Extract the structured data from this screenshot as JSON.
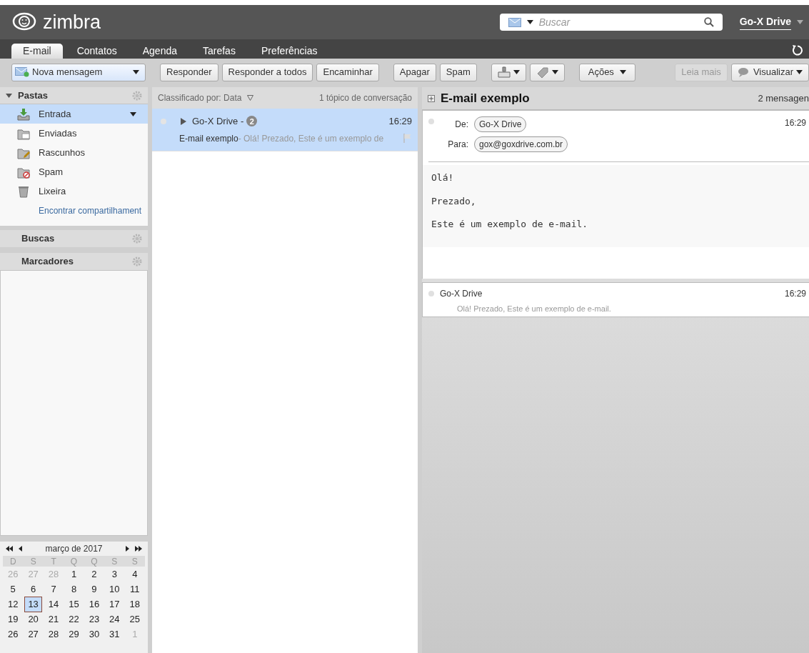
{
  "header": {
    "logo": "zimbra",
    "search": {
      "placeholder": "Buscar"
    },
    "user": "Go-X Drive"
  },
  "tabs": [
    {
      "label": "E-mail",
      "selected": true
    },
    {
      "label": "Contatos",
      "selected": false
    },
    {
      "label": "Agenda",
      "selected": false
    },
    {
      "label": "Tarefas",
      "selected": false
    },
    {
      "label": "Preferências",
      "selected": false
    }
  ],
  "toolbar": {
    "new_message": "Nova mensagem",
    "left_groups": [
      [
        {
          "kind": "text",
          "label": "Responder",
          "disabled": false
        },
        {
          "kind": "text",
          "label": "Responder a todos",
          "disabled": false
        },
        {
          "kind": "text",
          "label": "Encaminhar",
          "disabled": false
        }
      ],
      [
        {
          "kind": "text",
          "label": "Apagar",
          "disabled": false
        },
        {
          "kind": "text",
          "label": "Spam",
          "disabled": false
        }
      ],
      [
        {
          "kind": "move",
          "disabled": false
        },
        {
          "kind": "tag",
          "disabled": false
        }
      ],
      [
        {
          "kind": "menu",
          "label": "Ações",
          "disabled": false
        }
      ]
    ],
    "right_groups": [
      [
        {
          "kind": "text",
          "label": "Leia mais",
          "disabled": true
        },
        {
          "kind": "view",
          "label": "Visualizar",
          "disabled": false
        }
      ]
    ]
  },
  "sidebar": {
    "folders_title": "Pastas",
    "folders": [
      {
        "kind": "inbox",
        "label": "Entrada",
        "selected": true
      },
      {
        "kind": "sent",
        "label": "Enviadas",
        "selected": false
      },
      {
        "kind": "drafts",
        "label": "Rascunhos",
        "selected": false
      },
      {
        "kind": "spam",
        "label": "Spam",
        "selected": false
      },
      {
        "kind": "trash",
        "label": "Lixeira",
        "selected": false
      }
    ],
    "find_shares": "Encontrar compartilhament",
    "searches_title": "Buscas",
    "tags_title": "Marcadores"
  },
  "calendar": {
    "month": "março de 2017",
    "weekdays": [
      "D",
      "S",
      "T",
      "Q",
      "Q",
      "S",
      "S"
    ],
    "weeks": [
      [
        {
          "day": "26",
          "muted": true,
          "selected": false
        },
        {
          "day": "27",
          "muted": true,
          "selected": false
        },
        {
          "day": "28",
          "muted": true,
          "selected": false
        },
        {
          "day": "1",
          "muted": false,
          "selected": false
        },
        {
          "day": "2",
          "muted": false,
          "selected": false
        },
        {
          "day": "3",
          "muted": false,
          "selected": false
        },
        {
          "day": "4",
          "muted": false,
          "selected": false
        }
      ],
      [
        {
          "day": "5",
          "muted": false,
          "selected": false
        },
        {
          "day": "6",
          "muted": false,
          "selected": false
        },
        {
          "day": "7",
          "muted": false,
          "selected": false
        },
        {
          "day": "8",
          "muted": false,
          "selected": false
        },
        {
          "day": "9",
          "muted": false,
          "selected": false
        },
        {
          "day": "10",
          "muted": false,
          "selected": false
        },
        {
          "day": "11",
          "muted": false,
          "selected": false
        }
      ],
      [
        {
          "day": "12",
          "muted": false,
          "selected": false
        },
        {
          "day": "13",
          "muted": false,
          "selected": true
        },
        {
          "day": "14",
          "muted": false,
          "selected": false
        },
        {
          "day": "15",
          "muted": false,
          "selected": false
        },
        {
          "day": "16",
          "muted": false,
          "selected": false
        },
        {
          "day": "17",
          "muted": false,
          "selected": false
        },
        {
          "day": "18",
          "muted": false,
          "selected": false
        }
      ],
      [
        {
          "day": "19",
          "muted": false,
          "selected": false
        },
        {
          "day": "20",
          "muted": false,
          "selected": false
        },
        {
          "day": "21",
          "muted": false,
          "selected": false
        },
        {
          "day": "22",
          "muted": false,
          "selected": false
        },
        {
          "day": "23",
          "muted": false,
          "selected": false
        },
        {
          "day": "24",
          "muted": false,
          "selected": false
        },
        {
          "day": "25",
          "muted": false,
          "selected": false
        }
      ],
      [
        {
          "day": "26",
          "muted": false,
          "selected": false
        },
        {
          "day": "27",
          "muted": false,
          "selected": false
        },
        {
          "day": "28",
          "muted": false,
          "selected": false
        },
        {
          "day": "29",
          "muted": false,
          "selected": false
        },
        {
          "day": "30",
          "muted": false,
          "selected": false
        },
        {
          "day": "31",
          "muted": false,
          "selected": false
        },
        {
          "day": "1",
          "muted": true,
          "selected": false
        }
      ]
    ]
  },
  "message_list": {
    "sort": "Classificado por: Data",
    "count": "1 tópico de conversação",
    "items": [
      {
        "sender": "Go-X Drive -",
        "badge": "2",
        "time": "16:29",
        "subject": "E-mail exemplo",
        "preview": " - Olá! Prezado, Este é um exemplo de",
        "selected": true
      }
    ]
  },
  "reading_pane": {
    "subject": "E-mail exemplo",
    "count": "2 mensagen",
    "message": {
      "from_label": "De:",
      "from": "Go-X Drive",
      "to_label": "Para:",
      "to": "gox@goxdrive.com.br",
      "time": "16:29",
      "body": [
        "Olá!",
        "Prezado,",
        "Este é um exemplo de e-mail."
      ]
    },
    "collapsed": [
      {
        "sender": "Go-X Drive",
        "time": "16:29",
        "preview": "Olá! Prezado, Este é um exemplo de e-mail."
      }
    ]
  }
}
